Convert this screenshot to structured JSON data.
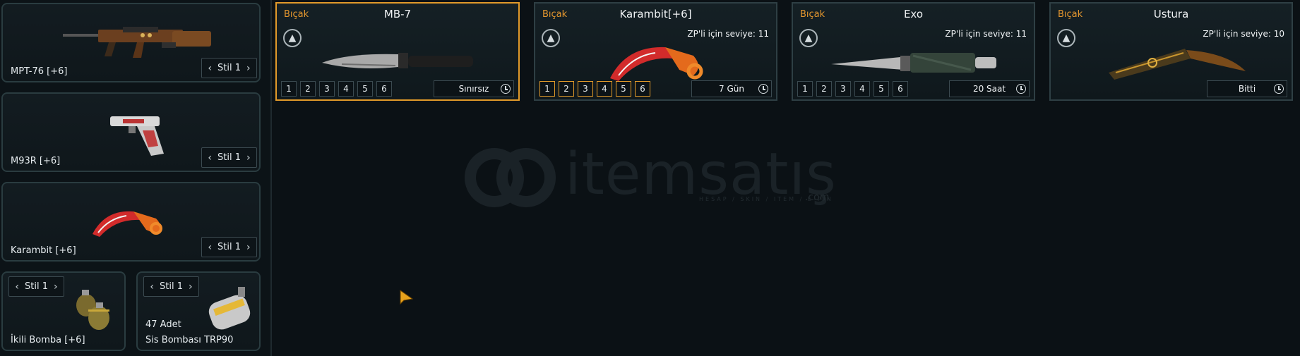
{
  "loadout": {
    "primary": {
      "name": "MPT-76 [+6]",
      "style": "Stil 1"
    },
    "secondary": {
      "name": "M93R [+6]",
      "style": "Stil 1"
    },
    "melee": {
      "name": "Karambit [+6]",
      "style": "Stil 1"
    },
    "grenade": {
      "name": "İkili Bomba [+6]",
      "style": "Stil 1"
    },
    "smoke": {
      "name": "Sis Bombası TRP90",
      "style": "Stil 1",
      "quantity": "47 Adet"
    }
  },
  "knives": [
    {
      "category": "Bıçak",
      "title": "MB-7",
      "level_req": "",
      "levels": [
        "1",
        "2",
        "3",
        "4",
        "5",
        "6"
      ],
      "duration": "Sınırsız",
      "selected": true
    },
    {
      "category": "Bıçak",
      "title": "Karambit[+6]",
      "level_req": "ZP'li için seviye: 11",
      "levels": [
        "1",
        "2",
        "3",
        "4",
        "5",
        "6"
      ],
      "duration": "7 Gün",
      "selected": false
    },
    {
      "category": "Bıçak",
      "title": "Exo",
      "level_req": "ZP'li için seviye: 11",
      "levels": [
        "1",
        "2",
        "3",
        "4",
        "5",
        "6"
      ],
      "duration": "20 Saat",
      "selected": false
    },
    {
      "category": "Bıçak",
      "title": "Ustura",
      "level_req": "ZP'li için seviye: 10",
      "levels": [],
      "duration": "Bitti",
      "selected": false
    }
  ],
  "watermark": {
    "brand": "itemsatış",
    "tagline": "HESAP / SKIN / ITEM / E-PIN",
    "domain": ".com"
  },
  "colors": {
    "accent": "#e19a2a",
    "panel_border": "#2a3c40",
    "background": "#0b1115"
  }
}
